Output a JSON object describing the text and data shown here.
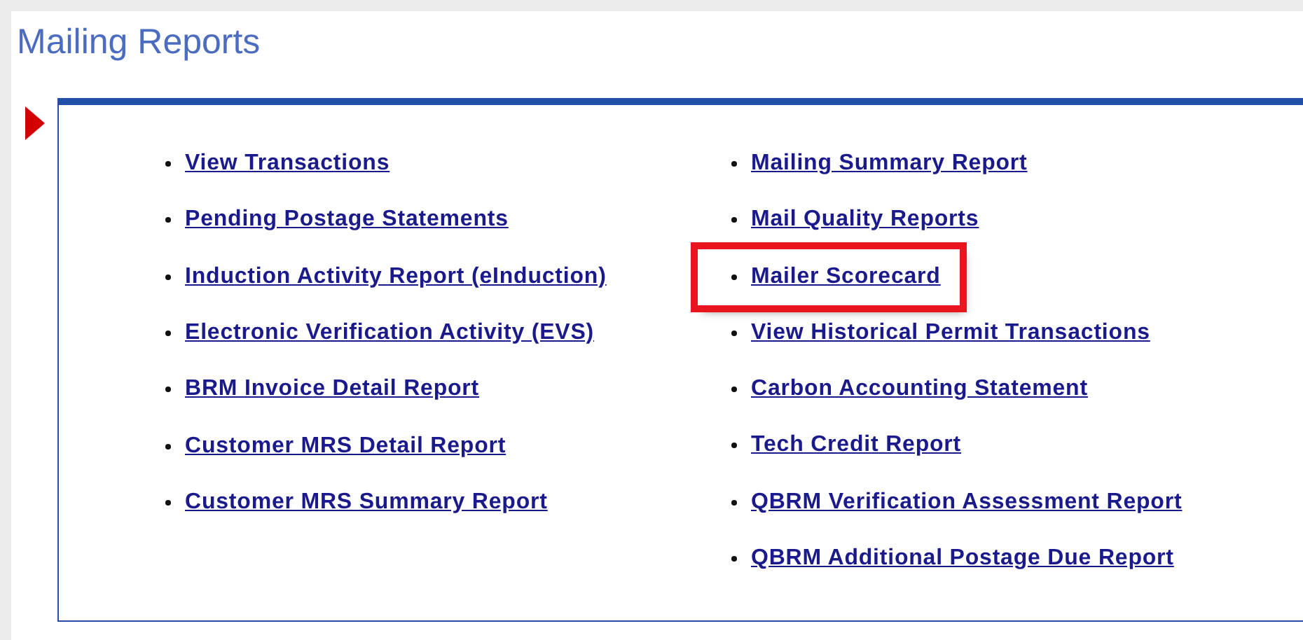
{
  "title": "Mailing Reports",
  "columns": [
    [
      {
        "label": "View Transactions",
        "highlighted": false
      },
      {
        "label": "Pending Postage Statements",
        "highlighted": false
      },
      {
        "label": "Induction Activity Report (eInduction)",
        "highlighted": false
      },
      {
        "label": "Electronic Verification Activity (EVS)",
        "highlighted": false
      },
      {
        "label": "BRM Invoice Detail Report",
        "highlighted": false
      },
      {
        "label": "Customer MRS Detail Report",
        "highlighted": false
      },
      {
        "label": "Customer MRS Summary Report",
        "highlighted": false
      }
    ],
    [
      {
        "label": "Mailing Summary Report",
        "highlighted": false
      },
      {
        "label": "Mail Quality Reports",
        "highlighted": false
      },
      {
        "label": "Mailer Scorecard",
        "highlighted": true
      },
      {
        "label": "View Historical Permit Transactions",
        "highlighted": false
      },
      {
        "label": "Carbon Accounting Statement",
        "highlighted": false
      },
      {
        "label": "Tech Credit Report",
        "highlighted": false
      },
      {
        "label": "QBRM Verification Assessment Report",
        "highlighted": false
      },
      {
        "label": "QBRM Additional Postage Due Report",
        "highlighted": false
      }
    ]
  ]
}
